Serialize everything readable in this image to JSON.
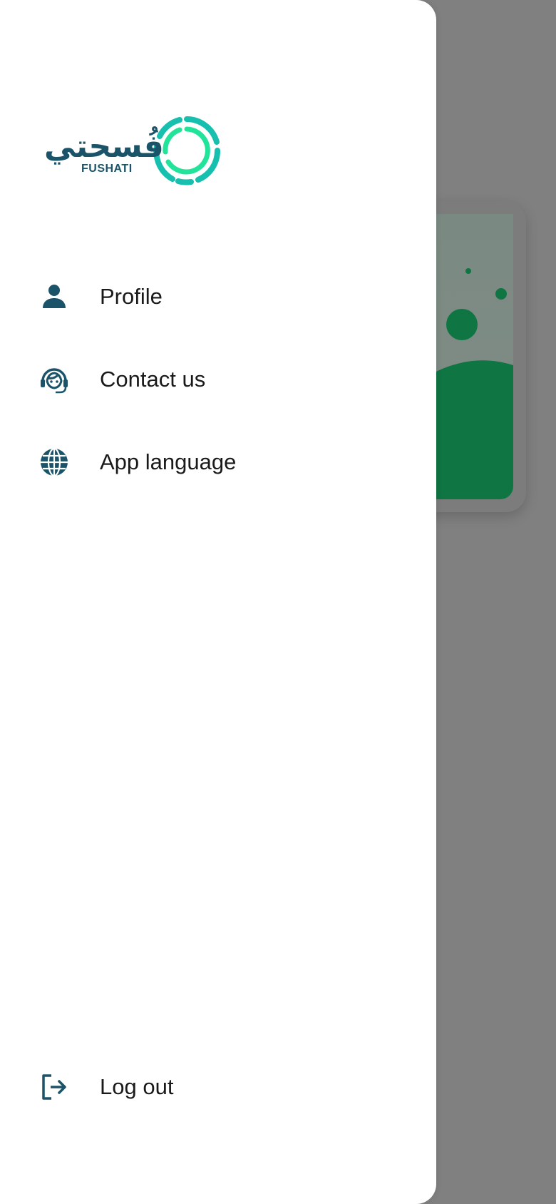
{
  "brand": {
    "arabic_name": "فُسحتي",
    "latin_name": "FUSHATI",
    "colors": {
      "primary": "#1b5468",
      "mark_outer": "#17bfae",
      "mark_inner": "#22e39a"
    }
  },
  "drawer": {
    "items": [
      {
        "label": "Profile",
        "icon": "person-icon"
      },
      {
        "label": "Contact us",
        "icon": "headset-icon"
      },
      {
        "label": "App language",
        "icon": "globe-icon"
      }
    ],
    "logout": {
      "label": "Log out",
      "icon": "logout-icon"
    }
  },
  "backdrop": {
    "scrim_color": "#808080",
    "illustration_green": "#0f7542"
  }
}
